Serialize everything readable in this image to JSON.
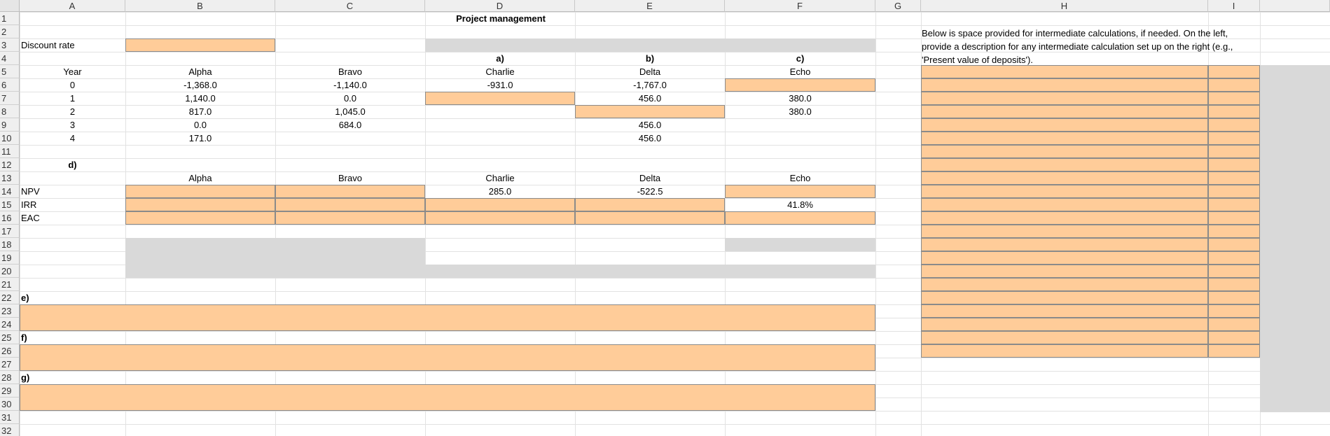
{
  "sheet": {
    "title": "Project management",
    "columns": [
      "A",
      "B",
      "C",
      "D",
      "E",
      "F",
      "G",
      "H",
      "I"
    ],
    "discount_rate_label": "Discount rate",
    "parts": {
      "a": "a)",
      "b": "b)",
      "c": "c)",
      "d": "d)",
      "e": "e)",
      "f": "f)",
      "g": "g)"
    },
    "year_label": "Year",
    "projects": [
      "Alpha",
      "Bravo",
      "Charlie",
      "Delta",
      "Echo"
    ],
    "years": [
      "0",
      "1",
      "2",
      "3",
      "4"
    ],
    "cashflows": {
      "alpha": [
        "-1,368.0",
        "1,140.0",
        "817.0",
        "0.0",
        "171.0"
      ],
      "bravo": [
        "-1,140.0",
        "0.0",
        "1,045.0",
        "684.0"
      ],
      "charlie": [
        "-931.0"
      ],
      "delta": [
        "-1,767.0",
        "456.0",
        "",
        "456.0",
        "456.0"
      ],
      "echo": [
        "",
        "380.0",
        "380.0"
      ]
    },
    "metrics": [
      "NPV",
      "IRR",
      "EAC"
    ],
    "values": {
      "charlie_npv": "285.0",
      "delta_npv": "-522.5",
      "echo_irr": "41.8%"
    },
    "note": "Below is space provided for intermediate calculations, if needed. On the left, provide a description for any intermediate calculation set up on the right (e.g., 'Present value of deposits')."
  },
  "colors": {
    "input": "#FFCC99",
    "gray": "#D9D9D9"
  }
}
